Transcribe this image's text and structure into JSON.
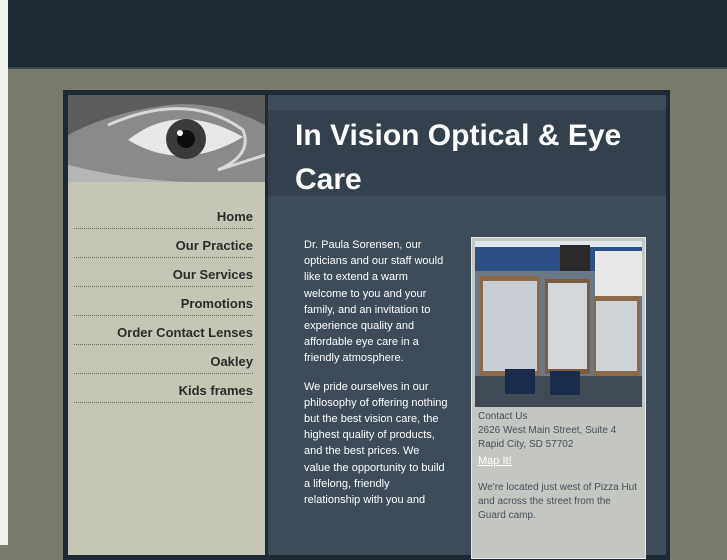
{
  "site": {
    "title": "In Vision Optical & Eye Care",
    "nav": [
      {
        "label": "Home"
      },
      {
        "label": "Our Practice"
      },
      {
        "label": "Our Services"
      },
      {
        "label": "Promotions"
      },
      {
        "label": "Order Contact Lenses"
      },
      {
        "label": "Oakley"
      },
      {
        "label": "Kids frames"
      }
    ]
  },
  "intro": {
    "paragraphs": [
      "Dr. Paula Sorensen, our opticians and our staff would like to extend a warm welcome to you and your family, and an invitation to experience quality and affordable eye care in a friendly atmosphere.",
      "We pride ourselves in our philosophy of offering nothing but the best vision care, the highest quality of products, and the best prices. We value the opportunity to build a lifelong, friendly relationship with you and"
    ]
  },
  "contact": {
    "heading": "Contact Us",
    "address_line1": "2626 West Main Street, Suite 4",
    "address_line2": "Rapid City, SD 57702",
    "map_link": "Map It!",
    "note": "We're located just west of Pizza Hut and across the street from the Guard camp."
  },
  "colors": {
    "page_bg": "#7a7a6e",
    "topbar": "#1f2b35",
    "sidebar": "#c5c6b6",
    "content": "#3e4b58"
  },
  "icons": {
    "header_image": "eye-closeup-photo",
    "store_image": "optical-store-photo"
  }
}
